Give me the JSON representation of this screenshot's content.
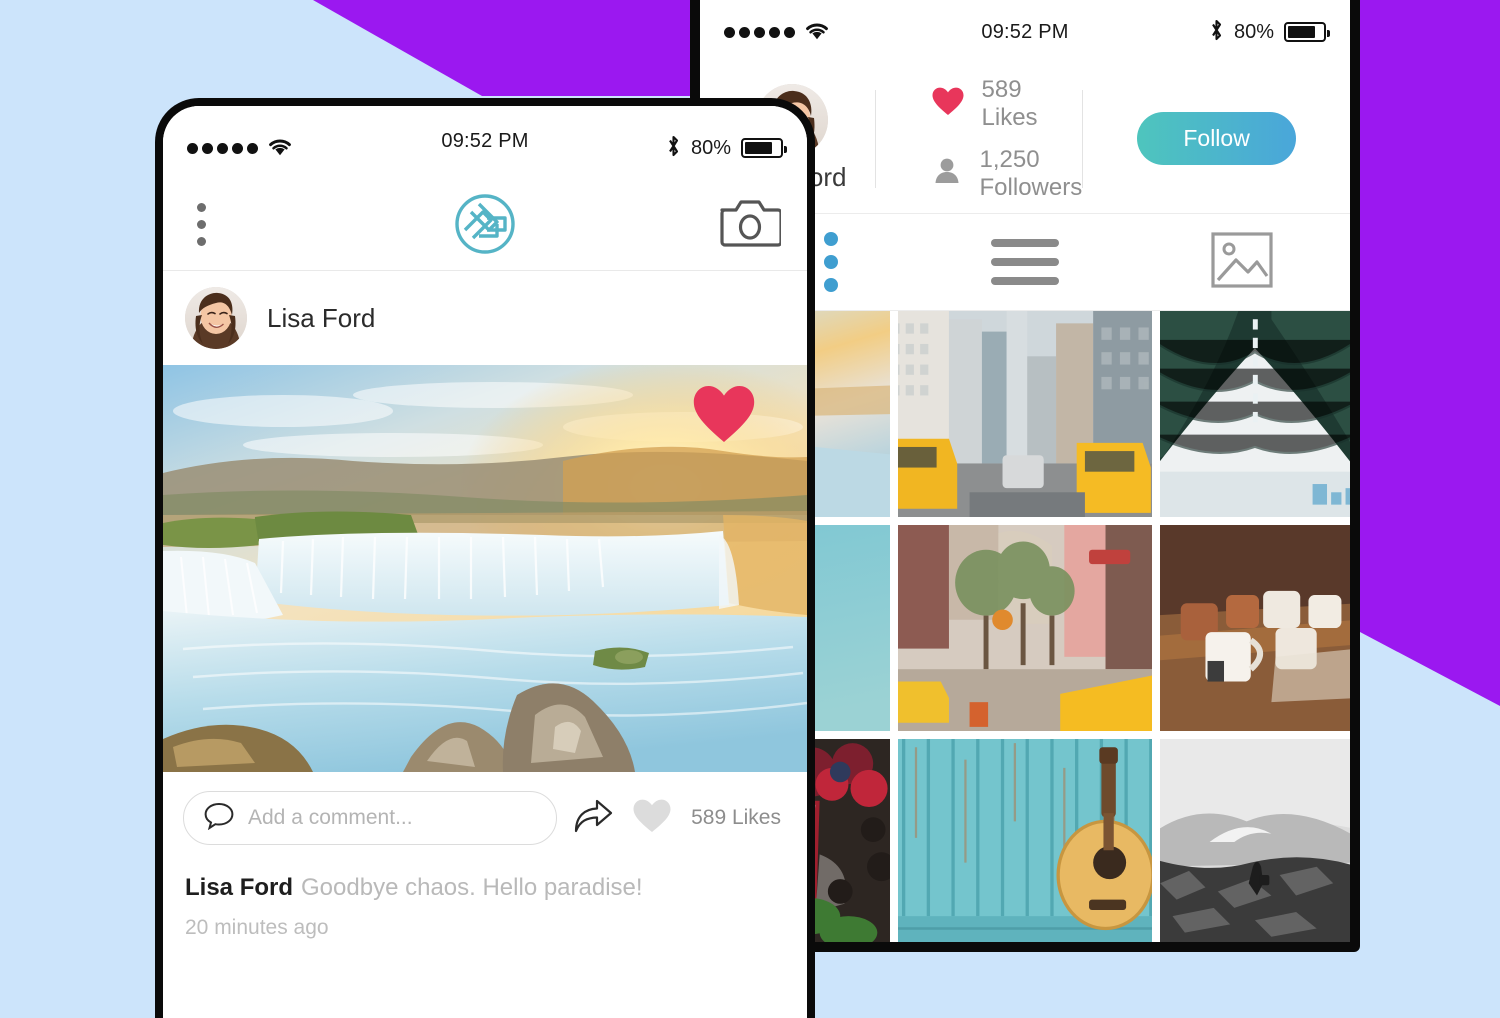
{
  "theme": {
    "bg_blue": "#cce4fb",
    "bg_purple": "#9b18f0",
    "brand_teal": "#4fb4c7",
    "heart_red": "#e8365b",
    "accent_blue": "#3f9ed0",
    "follow_from": "#4ec5bd",
    "follow_to": "#4aa6da",
    "frame_black": "#0a0a0a"
  },
  "left_phone": {
    "status_bar": {
      "signal_icon": "signal-dots-icon",
      "wifi_icon": "wifi-icon",
      "time": "09:52 PM",
      "bluetooth_icon": "bluetooth-icon",
      "battery_percent": "80%",
      "battery_icon": "battery-icon"
    },
    "app_bar": {
      "menu_icon": "kebab-menu-icon",
      "logo_icon": "app-logo-icon",
      "camera_icon": "camera-icon"
    },
    "post": {
      "author": "Lisa Ford",
      "avatar_icon": "user-avatar",
      "photo_alt": "waterfall-sunset-photo",
      "liked_heart_icon": "heart-filled-icon",
      "comment_placeholder": "Add a comment...",
      "comment_value": "",
      "comment_icon": "comment-bubble-icon",
      "share_icon": "share-arrow-icon",
      "like_icon": "heart-outline-icon",
      "likes_label": "589 Likes",
      "caption_author": "Lisa Ford",
      "caption_text": "Goodbye chaos. Hello paradise!",
      "timestamp": "20 minutes ago"
    }
  },
  "right_phone": {
    "status_bar": {
      "signal_icon": "signal-dots-icon",
      "wifi_icon": "wifi-icon",
      "time": "09:52 PM",
      "bluetooth_icon": "bluetooth-icon",
      "battery_percent": "80%",
      "battery_icon": "battery-icon"
    },
    "profile": {
      "avatar_icon": "user-avatar",
      "name": "Lisa Ford",
      "likes_icon": "heart-filled-icon",
      "likes_label": "589 Likes",
      "followers_icon": "person-icon",
      "followers_label": "1,250 Followers",
      "follow_button": "Follow"
    },
    "tabs": [
      {
        "name": "grid-view",
        "icon": "dot-grid-icon",
        "active": true
      },
      {
        "name": "list-view",
        "icon": "hamburger-list-icon",
        "active": false
      },
      {
        "name": "photo-view",
        "icon": "image-frame-icon",
        "active": false
      }
    ],
    "gallery": [
      {
        "alt": "waterfall-sunset",
        "kind": "waterfall"
      },
      {
        "alt": "city-street-taxis",
        "kind": "city-taxis"
      },
      {
        "alt": "bridge-underside",
        "kind": "bridge"
      },
      {
        "alt": "teal-sky",
        "kind": "teal"
      },
      {
        "alt": "street-with-trees-and-taxi",
        "kind": "street-trees"
      },
      {
        "alt": "enamel-mugs-on-table",
        "kind": "mugs"
      },
      {
        "alt": "berry-smoothie-jar",
        "kind": "smoothie"
      },
      {
        "alt": "guitar-on-blue-wood",
        "kind": "guitar"
      },
      {
        "alt": "hiker-on-mountain-bw",
        "kind": "hiker"
      }
    ]
  }
}
